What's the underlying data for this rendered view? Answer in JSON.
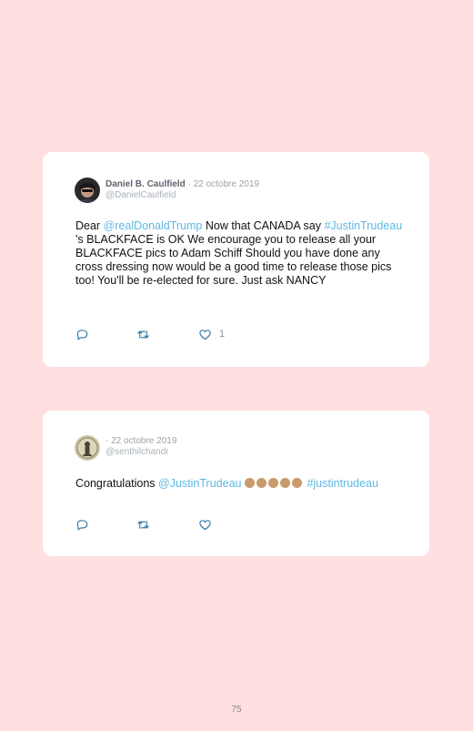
{
  "tweets": [
    {
      "author": "Daniel B. Caulfield",
      "date": "· 22 octobre 2019",
      "handle": "@DanielCaulfield",
      "text": {
        "t1": "Dear ",
        "m1": "@realDonaldTrump",
        "t2": " Now that CANADA say ",
        "m2": "#JustinTrudeau",
        "t3": " 's BLACKFACE is OK We encourage you to release all your BLACKFACE pics to Adam Schiff Should you have done any cross dressing now would be a good time to release those pics too! You'll be re-elected for sure. Just ask NANCY"
      },
      "likes": "1"
    },
    {
      "author": "",
      "date": "· 22 octobre 2019",
      "handle": "@senthilchandr",
      "text": {
        "t1": "Congratulations ",
        "m1": "@JustinTrudeau",
        "m2": "#justintrudeau"
      }
    }
  ],
  "icons": {
    "reply": "reply-icon",
    "retweet": "retweet-icon",
    "like": "heart-icon",
    "clap": "clapping-hands-emoji"
  },
  "colors": {
    "background": "#ffdfe0",
    "link": "#5fb8e6"
  },
  "page_number": "75"
}
